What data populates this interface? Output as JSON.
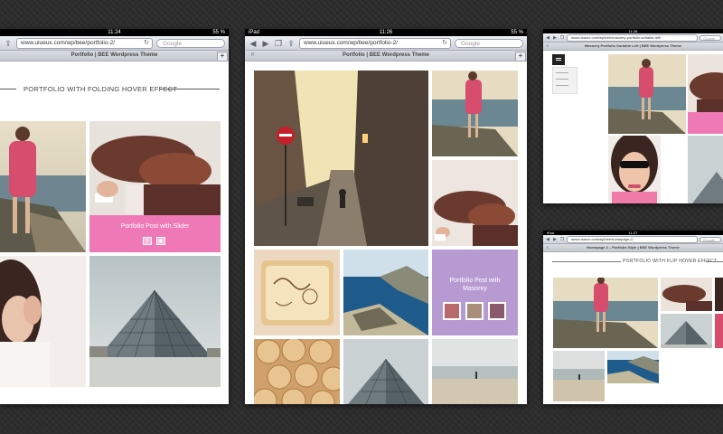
{
  "left_tablet": {
    "status": {
      "time": "11:24",
      "battery": "55 %"
    },
    "url": "www.uiueux.com/wp/bee/portfolio-2/",
    "search_placeholder": "Google",
    "tab_title": "Portfolio | BEE Wordpress Theme",
    "heading": "PORTFOLIO WITH FOLDING HOVER EFFECT",
    "hover_card": {
      "title": "Portfolio Post with Slider",
      "color": "#ef78b7"
    }
  },
  "center_tablet": {
    "status": {
      "carrier": "iPad",
      "time": "11:26",
      "battery": "55 %"
    },
    "url": "www.uiueux.com/wp/bee/portfolio-2/",
    "search_placeholder": "Google",
    "tab_title": "Portfolio | BEE Wordpress Theme",
    "hover_card": {
      "title": "Portfolio Post with Masonry",
      "color": "#b89ad2"
    }
  },
  "right_top_tablet": {
    "status": {
      "time": "11:26"
    },
    "url": "www.uiueux.com/wp/bee/masonry-portfolio-sortable-left/",
    "search_placeholder": "Google",
    "tab_title": "Masonry Portfolio Sortable Left | BEE Wordpress Theme",
    "accent": "#ef78b7"
  },
  "right_bottom_tablet": {
    "status": {
      "carrier": "iPad",
      "time": "11:27"
    },
    "url": "www.uiueux.com/wp/bee/homepage-2/",
    "search_placeholder": "Google",
    "tab_title": "Homepage 2 – Portfolio Style | BEE Wordpress Theme",
    "heading": "PORTFOLIO WITH FLIP HOVER EFFECT"
  },
  "icons": {
    "back": "back-arrow-icon",
    "forward": "forward-arrow-icon",
    "bookmarks": "book-icon",
    "share": "share-icon",
    "reload": "reload-icon",
    "search": "search-icon",
    "tab_add": "plus-icon",
    "tab_close": "close-icon"
  }
}
